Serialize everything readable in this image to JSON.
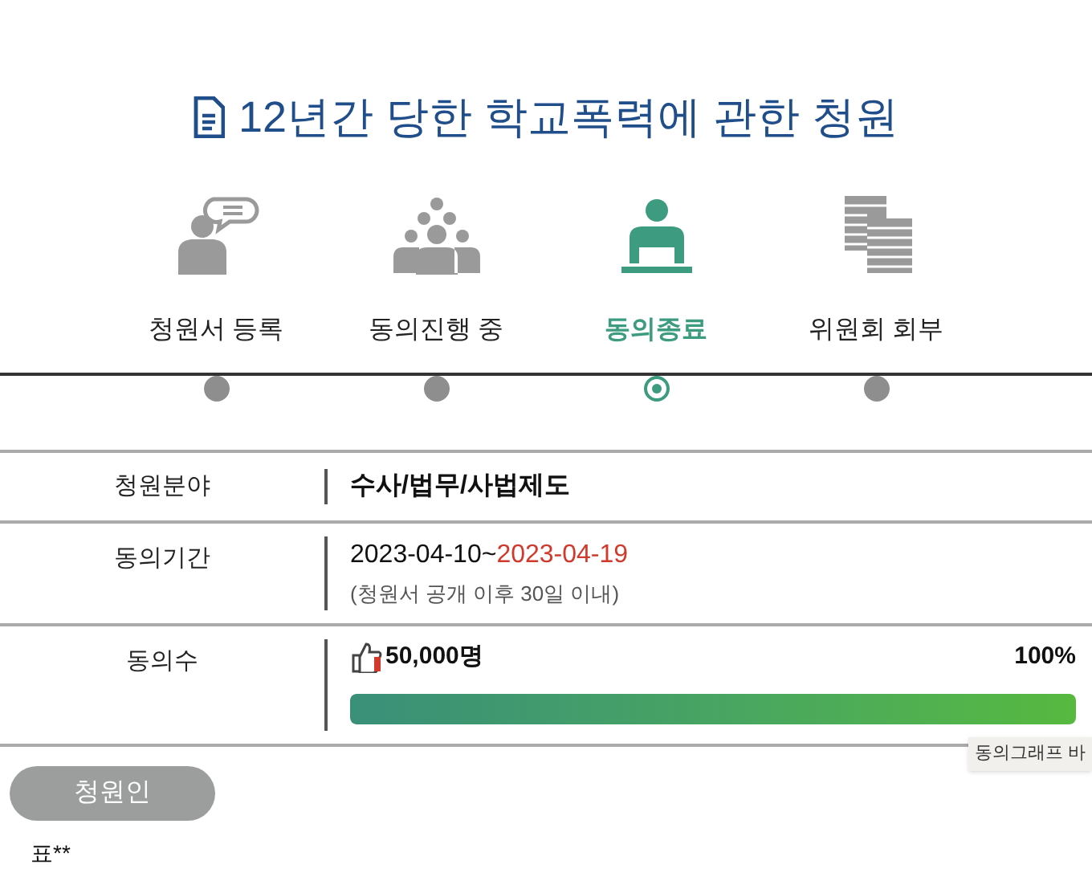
{
  "title": "12년간 당한 학교폭력에 관한 청원",
  "steps": [
    {
      "label": "청원서 등록",
      "selected": false
    },
    {
      "label": "동의진행 중",
      "selected": false
    },
    {
      "label": "동의종료",
      "selected": true
    },
    {
      "label": "위원회 회부",
      "selected": false
    }
  ],
  "rows": [
    {
      "kind": "text",
      "label": "청원분야",
      "value": "수사/법무/사법제도"
    },
    {
      "kind": "period",
      "label": "동의기간",
      "start": "2023-04-10~",
      "end": "2023-04-19",
      "note": "(청원서 공개 이후 30일 이내)"
    },
    {
      "kind": "count",
      "label": "동의수",
      "count": "50,000명",
      "percent": "100%",
      "level": 1
    }
  ],
  "tooltip": "동의그래프 바",
  "petitioner": {
    "button": "청원인",
    "name": "표**"
  }
}
